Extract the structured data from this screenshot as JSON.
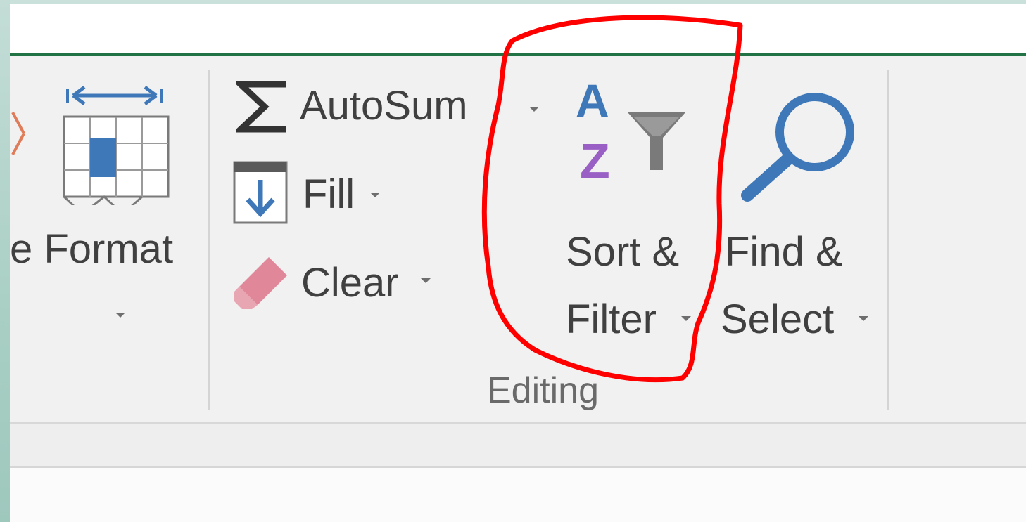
{
  "ribbon": {
    "cells_group": {
      "format_button": {
        "label": "e Format",
        "icon": "format-cells-icon"
      },
      "delete_icon_fragment": "delete-cells-icon"
    },
    "editing_group": {
      "group_label": "Editing",
      "autosum": {
        "label": "AutoSum",
        "icon": "sigma-icon"
      },
      "fill": {
        "label": "Fill",
        "icon": "fill-down-icon"
      },
      "clear": {
        "label": "Clear",
        "icon": "eraser-icon"
      },
      "sort_filter": {
        "label_line1": "Sort &",
        "label_line2": "Filter",
        "icon": "sort-filter-icon",
        "sort_letters": {
          "top": "A",
          "bottom": "Z"
        }
      },
      "find_select": {
        "label_line1": "Find &",
        "label_line2": "Select",
        "icon": "magnifier-icon"
      }
    }
  },
  "colors": {
    "accent_green": "#217346",
    "icon_blue": "#3f78b8",
    "sort_purple": "#9a5fc4",
    "eraser_pink": "#e0889a",
    "highlight_red": "#ff0000",
    "delete_orange": "#e07c5a"
  }
}
